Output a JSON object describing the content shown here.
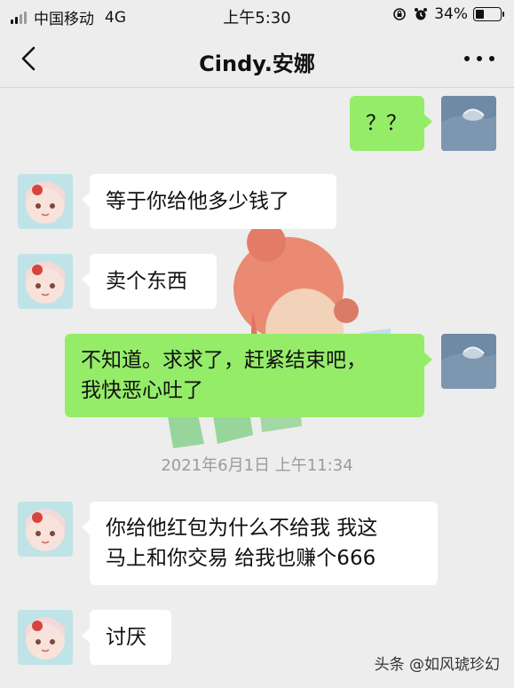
{
  "status_bar": {
    "carrier": "中国移动",
    "network": "4G",
    "time": "上午5:30",
    "battery": "34%",
    "battery_level": 0.34,
    "icons": [
      "lock-rotation-icon",
      "alarm-icon"
    ]
  },
  "header": {
    "title": "Cindy.安娜",
    "back_icon": "chevron-left-icon",
    "more_icon": "more-dots-icon"
  },
  "messages": [
    {
      "side": "out",
      "text": "？？"
    },
    {
      "side": "in",
      "text": "等于你给他多少钱了"
    },
    {
      "side": "in",
      "text": "卖个东西"
    },
    {
      "side": "out",
      "text_line1": "不知道。求求了，赶紧结束吧，",
      "text_line2": "我快恶心吐了"
    },
    {
      "side": "in",
      "text_line1": "你给他红包为什么不给我 我这",
      "text_line2": "马上和你交易 给我也赚个666"
    },
    {
      "side": "in",
      "text": "讨厌"
    }
  ],
  "timestamp": "2021年6月1日 上午11:34",
  "watermark": {
    "footer": "头条 @如风琥珍幻",
    "art_text": "如风琥珍幻"
  },
  "colors": {
    "background": "#ededed",
    "bubble_out": "#95ec69",
    "bubble_in": "#ffffff",
    "timestamp": "#9b9b9b"
  }
}
